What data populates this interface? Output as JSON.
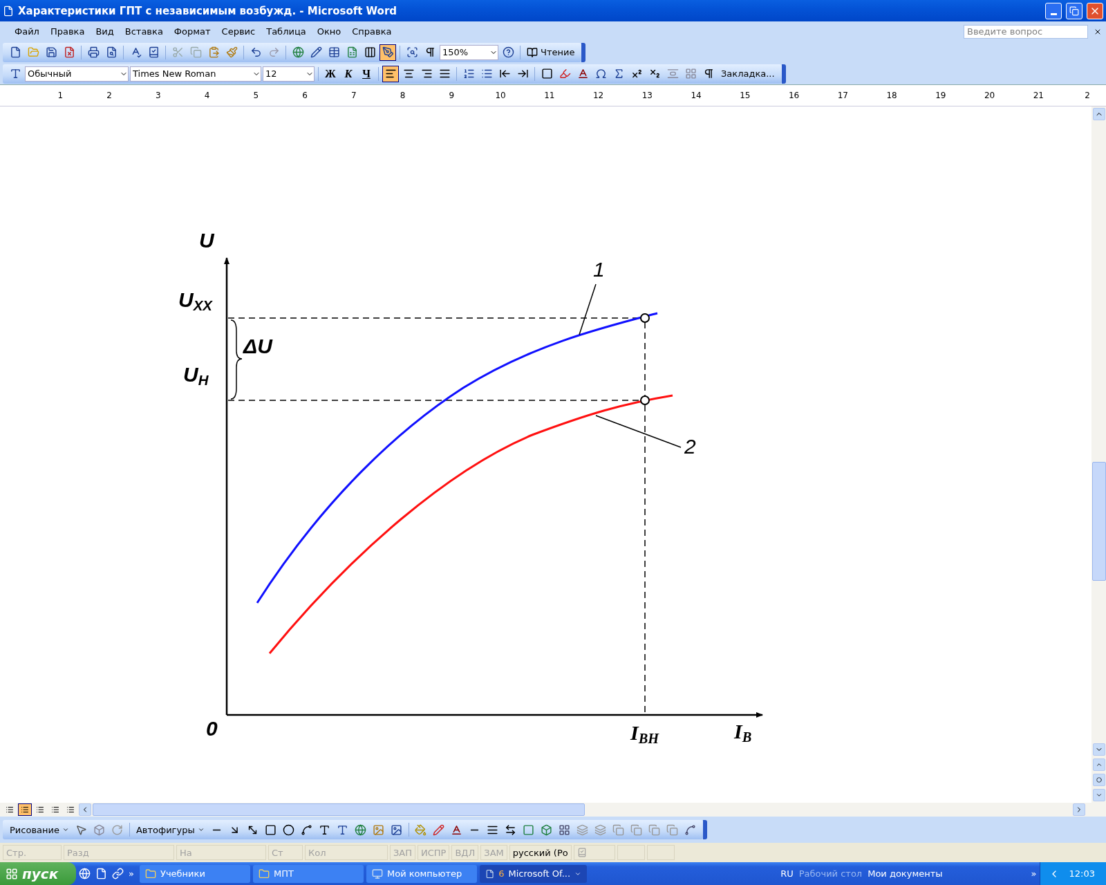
{
  "window": {
    "title": "Характеристики ГПТ с независимым возбужд. - Microsoft Word"
  },
  "menu": [
    "Файл",
    "Правка",
    "Вид",
    "Вставка",
    "Формат",
    "Сервис",
    "Таблица",
    "Окно",
    "Справка"
  ],
  "help_box": {
    "placeholder": "Введите вопрос"
  },
  "standard_toolbar": {
    "zoom": "150%",
    "reading_button": "Чтение",
    "drawing_toggle_selected": true
  },
  "formatting_toolbar": {
    "style": "Обычный",
    "font": "Times New Roman",
    "size": "12",
    "bold": "Ж",
    "italic": "К",
    "underline": "Ч",
    "alignment": [
      {
        "selected": true
      },
      {
        "selected": false
      },
      {
        "selected": false
      },
      {
        "selected": false
      }
    ],
    "bookmark_button": "Закладка..."
  },
  "ruler": {
    "numbers": [
      "1",
      "2",
      "3",
      "4",
      "5",
      "6",
      "7",
      "8",
      "9",
      "10",
      "11",
      "12",
      "13",
      "14",
      "15",
      "16",
      "17",
      "18",
      "19",
      "20",
      "21",
      "2"
    ]
  },
  "figure": {
    "y_axis_label": "U",
    "no_load_voltage": "U$_{XX}$",
    "voltage_drop": "ΔU",
    "rated_voltage": "U$_{H}$",
    "origin": "0",
    "rated_current": "I$_{BH}$",
    "x_axis_label": "I$_{B}$",
    "curve_1_label": "1",
    "curve_2_label": "2"
  },
  "view_buttons": [
    {
      "selected": false
    },
    {
      "selected": true
    },
    {
      "selected": false
    },
    {
      "selected": false
    },
    {
      "selected": false
    }
  ],
  "drawing_toolbar": {
    "draw_menu": "Рисование",
    "autoshapes_menu": "Автофигуры"
  },
  "status_bar": {
    "fields": [
      "Стр.",
      "Разд",
      "На",
      "Ст",
      "Кол"
    ],
    "modes": [
      {
        "label": "ЗАП",
        "on": false
      },
      {
        "label": "ИСПР",
        "on": false
      },
      {
        "label": "ВДЛ",
        "on": false
      },
      {
        "label": "ЗАМ",
        "on": false
      }
    ],
    "language": "русский (Ро"
  },
  "taskbar": {
    "start": "пуск",
    "overflow": "»",
    "buttons": [
      {
        "kind": "folder",
        "label": "Учебники",
        "selected": false
      },
      {
        "kind": "folder",
        "label": "МПТ",
        "selected": false
      },
      {
        "kind": "computer",
        "label": "Мой компьютер",
        "selected": false
      },
      {
        "kind": "word",
        "count": "6",
        "label": "Microsoft Of...",
        "selected": true
      }
    ],
    "language": "RU",
    "desktop_toolbar": "Рабочий стол",
    "documents_link": "Мои документы",
    "tray_overflow": "»",
    "clock": "12:03"
  }
}
